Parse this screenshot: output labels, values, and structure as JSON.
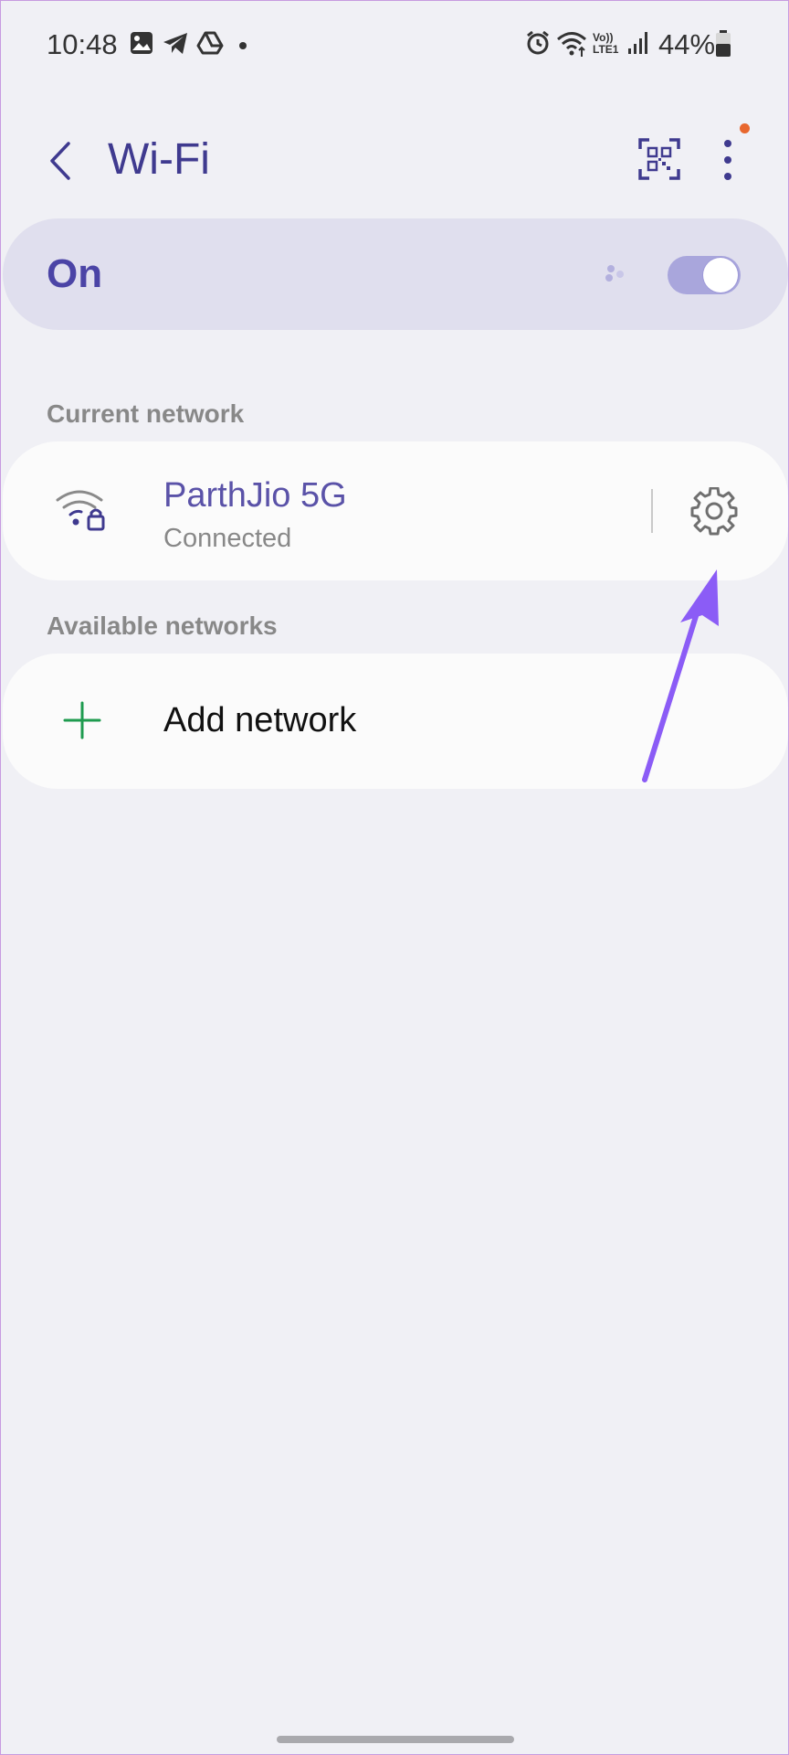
{
  "status_bar": {
    "time": "10:48",
    "icons": [
      "gallery-icon",
      "telegram-icon",
      "drive-icon",
      "dot-icon",
      "alarm-icon",
      "wifi-icon",
      "volte-icon",
      "signal-icon",
      "battery-icon"
    ],
    "volte_text_top": "Vo))",
    "volte_text_bottom": "LTE1",
    "battery_percent": "44%"
  },
  "header": {
    "title": "Wi-Fi",
    "icons": [
      "back-icon",
      "qr-code-icon",
      "more-options-icon"
    ],
    "notification_dot_color": "#e8672e"
  },
  "wifi_toggle": {
    "label": "On",
    "state": "on",
    "accent_color": "#4b44a6"
  },
  "current_network": {
    "section_label": "Current network",
    "name": "ParthJio 5G",
    "status": "Connected",
    "icons": [
      "wifi-lock-icon",
      "settings-gear-icon"
    ]
  },
  "available_networks": {
    "section_label": "Available networks",
    "add_label": "Add network",
    "add_icon": "plus-icon",
    "add_icon_color": "#1e9b4f"
  },
  "annotation": {
    "type": "arrow",
    "color": "#8b5cf6",
    "points_to": "settings-gear-icon"
  }
}
